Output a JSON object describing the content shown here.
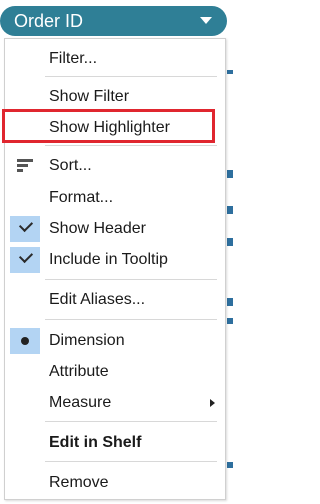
{
  "pill": {
    "label": "Order ID",
    "color": "#2f7f96"
  },
  "menu": {
    "items": [
      {
        "label": "Filter..."
      },
      {
        "label": "Show Filter"
      },
      {
        "label": "Show Highlighter"
      },
      {
        "label": "Sort...",
        "icon": "sort-icon",
        "highlighted": true
      },
      {
        "label": "Format..."
      },
      {
        "label": "Show Header",
        "checked": true
      },
      {
        "label": "Include in Tooltip",
        "checked": true
      },
      {
        "label": "Edit Aliases..."
      },
      {
        "label": "Dimension",
        "selected": true
      },
      {
        "label": "Attribute"
      },
      {
        "label": "Measure",
        "submenu": true
      },
      {
        "label": "Edit in Shelf",
        "bold": true
      },
      {
        "label": "Remove"
      }
    ]
  },
  "colors": {
    "highlight": "#e0262f",
    "selection": "#b3d4f3",
    "accent": "#2e6f9e"
  }
}
